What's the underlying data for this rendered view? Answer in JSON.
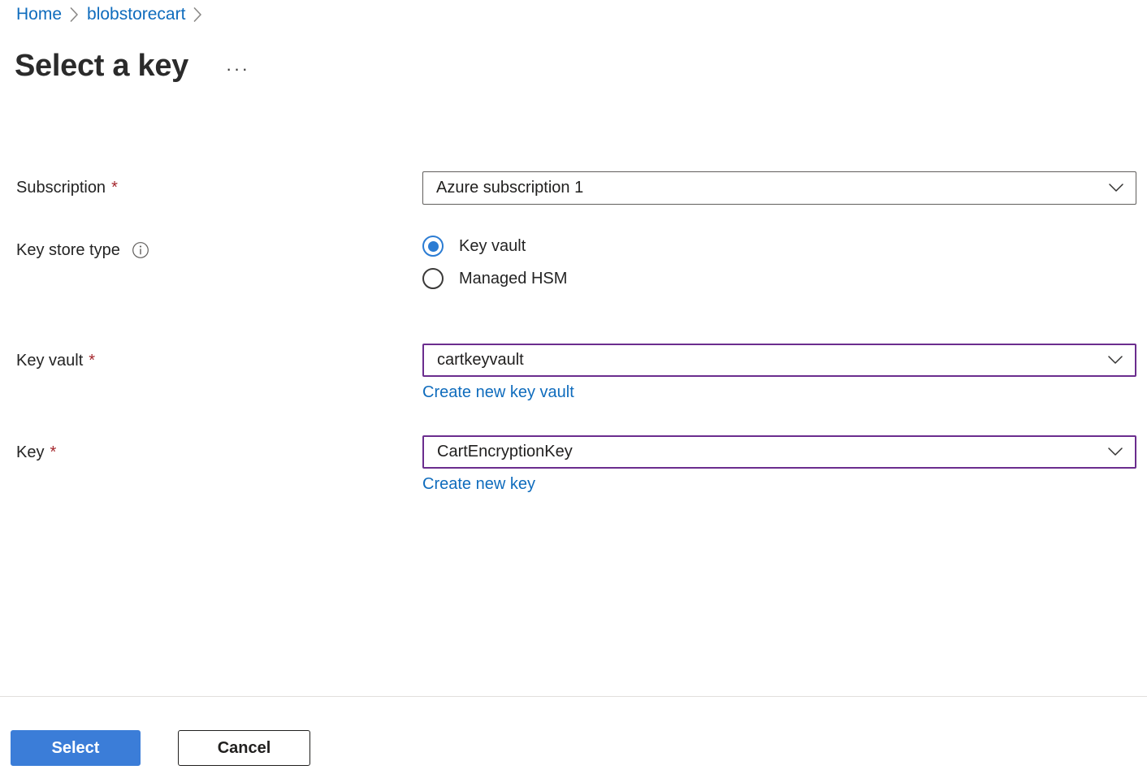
{
  "breadcrumb": {
    "items": [
      {
        "label": "Home"
      },
      {
        "label": "blobstorecart"
      }
    ],
    "trailing_separator": true
  },
  "header": {
    "title": "Select a key",
    "more_menu": "···"
  },
  "form": {
    "subscription": {
      "label": "Subscription",
      "required_marker": "*",
      "value": "Azure subscription 1",
      "chevron": "chevron-down-icon"
    },
    "key_store_type": {
      "label": "Key store type",
      "info_icon": "info-icon",
      "options": [
        {
          "label": "Key vault",
          "selected": true
        },
        {
          "label": "Managed HSM",
          "selected": false
        }
      ]
    },
    "key_vault": {
      "label": "Key vault",
      "required_marker": "*",
      "value": "cartkeyvault",
      "create_link": "Create new key vault",
      "chevron": "chevron-down-icon"
    },
    "key": {
      "label": "Key",
      "required_marker": "*",
      "value": "CartEncryptionKey",
      "create_link": "Create new key",
      "chevron": "chevron-down-icon"
    }
  },
  "footer": {
    "select_label": "Select",
    "cancel_label": "Cancel"
  },
  "colors": {
    "link": "#0f6cbd",
    "required_asterisk": "#a4262c",
    "accent_field_border": "#6b2d8e",
    "radio_selected": "#2b7cd3",
    "primary_button": "#3b7dd8",
    "divider": "#e1dfdd",
    "field_border": "#605e5c"
  }
}
